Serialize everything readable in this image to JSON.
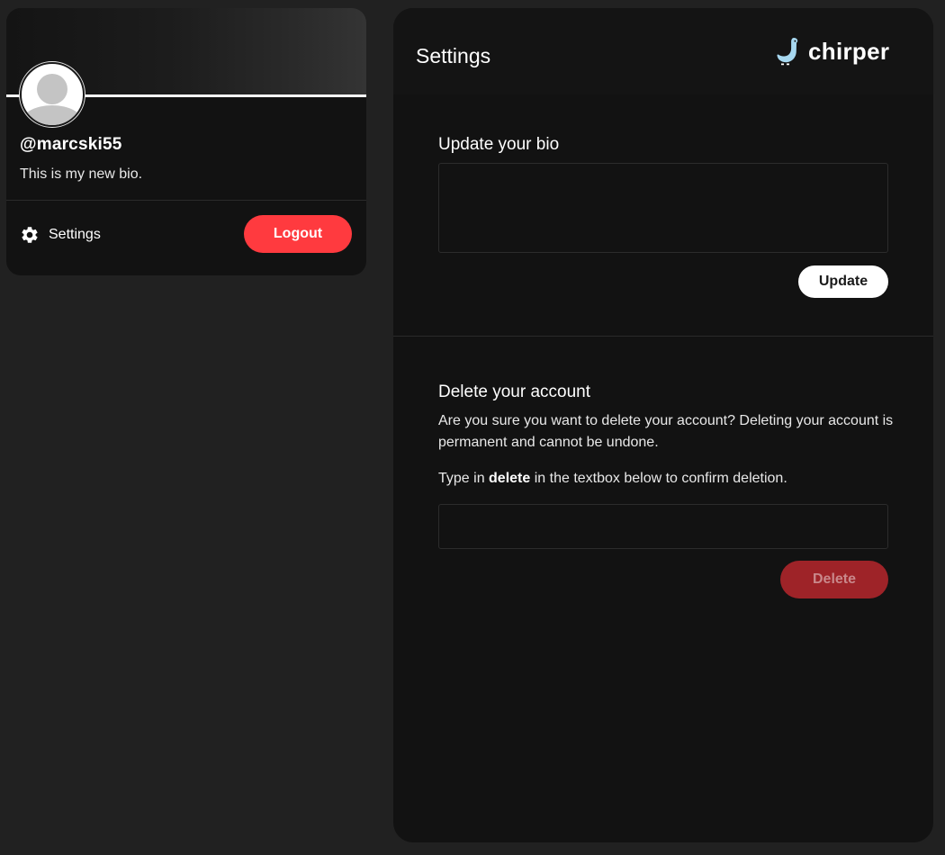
{
  "profile": {
    "username": "@marcski55",
    "bio": "This is my new bio.",
    "settings_label": "Settings",
    "logout_label": "Logout"
  },
  "settings_page": {
    "title": "Settings",
    "logo_text": "chirper",
    "bio_section": {
      "heading": "Update your bio",
      "input_value": "",
      "update_label": "Update"
    },
    "delete_section": {
      "heading": "Delete your account",
      "warning": "Are you sure you want to delete your account? Deleting your account is permanent and cannot be undone.",
      "instruction_prefix": "Type in ",
      "instruction_keyword": "delete",
      "instruction_suffix": " in the textbox below to confirm deletion.",
      "input_value": "",
      "delete_label": "Delete"
    }
  },
  "icons": {
    "gear": "gear-icon",
    "logo": "bird-icon",
    "avatar": "default-user-icon"
  },
  "colors": {
    "page_background": "#212121",
    "card_background": "#121212",
    "logout_red": "#ff3a3f",
    "delete_disabled_red": "#9e2328",
    "logo_blue": "#a7d8f0"
  }
}
